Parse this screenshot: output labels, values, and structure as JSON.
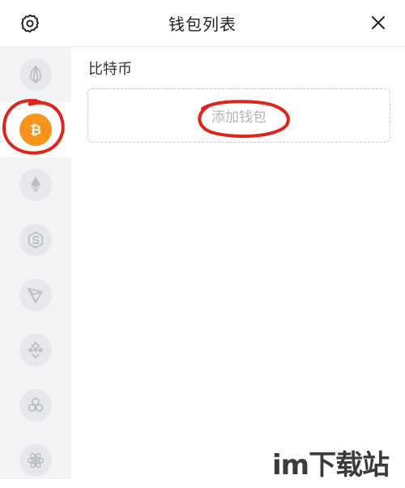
{
  "header": {
    "title": "钱包列表",
    "settings_icon": "gear-icon",
    "close_icon": "close-icon"
  },
  "sidebar": {
    "items": [
      {
        "icon": "eos-icon",
        "active": false
      },
      {
        "icon": "bitcoin-icon",
        "active": true,
        "color": "#f7931a"
      },
      {
        "icon": "ethereum-icon",
        "active": false
      },
      {
        "icon": "sero-icon",
        "active": false
      },
      {
        "icon": "tron-icon",
        "active": false
      },
      {
        "icon": "binance-icon",
        "active": false
      },
      {
        "icon": "cosmos-icon",
        "active": false
      },
      {
        "icon": "atom-icon",
        "active": false
      }
    ]
  },
  "main": {
    "section_title": "比特币",
    "add_wallet_label": "添加钱包"
  },
  "annotation": {
    "color": "#e0231b"
  },
  "watermark": {
    "text": "im下载站"
  }
}
